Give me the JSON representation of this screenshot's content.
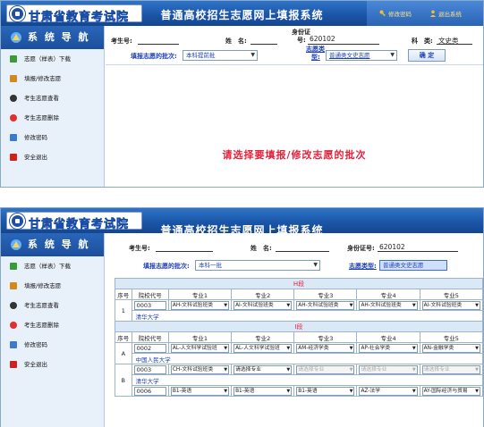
{
  "header": {
    "logo_text": "甘肃省教育考试院",
    "title": "普通高校招生志愿网上填报系统",
    "link_change_password": "修改密码",
    "link_logout": "退出系统"
  },
  "sidebar": {
    "title": "系 统 导 航",
    "items": [
      {
        "label": "志愿（样表）下载",
        "color": "#3b9b3b"
      },
      {
        "label": "填报/修改志愿",
        "color": "#d08a1c"
      },
      {
        "label": "考生志愿查看",
        "color": "#333333"
      },
      {
        "label": "考生志愿删除",
        "color": "#e03030"
      },
      {
        "label": "修改密码",
        "color": "#3a7ad0"
      },
      {
        "label": "安全退出",
        "color": "#d02020"
      }
    ]
  },
  "panel1": {
    "candidate_no_label": "考生号:",
    "name_label": "姓　名:",
    "id_label_line1": "身份证",
    "id_label_line2": "号:",
    "id_value": "620102",
    "category_label": "科　类:",
    "category_value": "文史类",
    "batch_label": "填报志愿的批次:",
    "batch_value": "本科提前批",
    "type_label_line1": "志愿类",
    "type_label_line2": "型:",
    "type_value": "普通类文史志愿",
    "confirm_button": "确 定",
    "center_message": "请选择要填报/修改志愿的批次"
  },
  "panel2": {
    "candidate_no_label": "考生号:",
    "name_label": "姓　名:",
    "id_label": "身份证号:",
    "id_value": "620102",
    "batch_label": "填报志愿的批次:",
    "batch_value": "本科一批",
    "type_label": "志愿类型:",
    "type_value": "普通类文史志愿",
    "sections": [
      {
        "segment": "H段",
        "headers": [
          "序号",
          "院校代号",
          "专业1",
          "专业2",
          "专业3",
          "专业4",
          "专业5"
        ],
        "groups": [
          {
            "seq": "1",
            "rows": [
              {
                "code": "0003",
                "majors": [
                  "AH-文科试验班类",
                  "AI-文科试验班类",
                  "AH-文科试验班类",
                  "AH-文科试验班类",
                  "AI-文科试验班类"
                ],
                "disabled": false
              }
            ],
            "school": "清华大学"
          }
        ]
      },
      {
        "segment": "I段",
        "headers": [
          "序号",
          "院校代号",
          "专业1",
          "专业2",
          "专业3",
          "专业4",
          "专业5"
        ],
        "groups": [
          {
            "seq": "A",
            "rows": [
              {
                "code": "0002",
                "majors": [
                  "AL-人文科学试验班",
                  "AL-人文科学试验班",
                  "AM-经济学类",
                  "AP-社会学类",
                  "AN-金融学类"
                ],
                "disabled": false
              }
            ],
            "school": "中国人民大学"
          },
          {
            "seq": "B",
            "rows": [
              {
                "code": "0003",
                "majors": [
                  "CH-文科试验班类",
                  "请选择专业",
                  "请选择专业",
                  "请选择专业",
                  "请选择专业"
                ],
                "disabled": true
              }
            ],
            "school": "清华大学"
          },
          {
            "seq": "",
            "rows": [
              {
                "code": "0006",
                "majors": [
                  "B1-英语",
                  "B1-英语",
                  "B1-英语",
                  "AZ-法学",
                  "AY-国际经济与贸易"
                ],
                "disabled": false
              }
            ],
            "school": ""
          }
        ]
      }
    ]
  }
}
